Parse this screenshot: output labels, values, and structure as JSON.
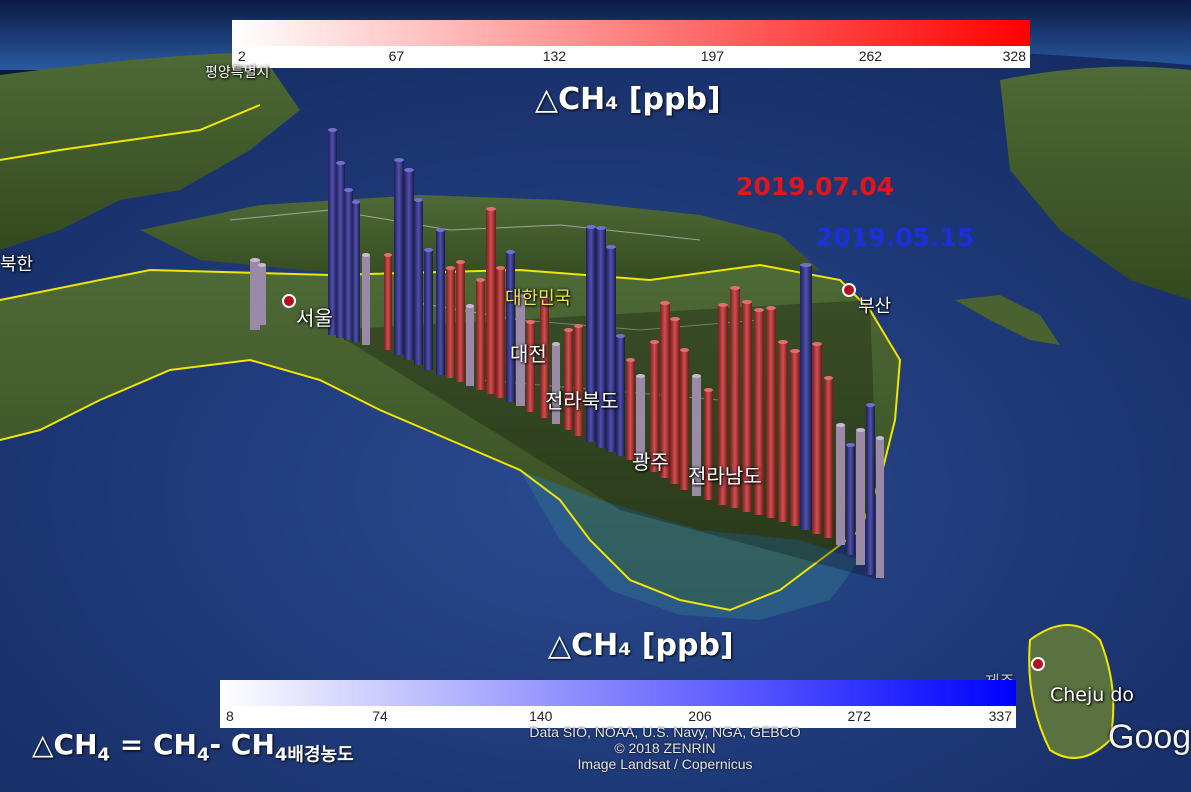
{
  "colorbar_red": {
    "ticks": [
      "2",
      "67",
      "132",
      "197",
      "262",
      "328"
    ],
    "start_color": "#ffffff",
    "end_color": "#ff0000"
  },
  "colorbar_blue": {
    "ticks": [
      "8",
      "74",
      "140",
      "206",
      "272",
      "337"
    ],
    "start_color": "#ffffff",
    "end_color": "#0000ff"
  },
  "unit_label_top": "△CH₄ [ppb]",
  "unit_label_bottom": "△CH₄ [ppb]",
  "dates": {
    "red": {
      "text": "2019.07.04",
      "color": "#e0161c"
    },
    "blue": {
      "text": "2019.05.15",
      "color": "#1a2fe0"
    }
  },
  "map_labels": {
    "north_korea": "북한",
    "pyongyang": "평양특별시",
    "seoul": "서울",
    "south_korea": "대한민국",
    "daejeon": "대전",
    "jeonbuk": "전라북도",
    "gwangju": "광주",
    "jeonnam": "전라남도",
    "busan": "부산",
    "jeju_hangul": "제주",
    "jeju": "Cheju do"
  },
  "attribution": [
    "Data SIO, NOAA, U.S. Navy, NGA, GEBCO",
    "© 2018 ZENRIN",
    "Image Landsat / Copernicus"
  ],
  "google_logo": "Goog",
  "formula": {
    "lhs_sym": "△CH",
    "lhs_sub": "4",
    "eq": " = CH",
    "ch4_sub": "4",
    "minus": "- CH",
    "bg_sub": "4배경농도"
  },
  "colors": {
    "sea": "#1d3a78",
    "land": "#3f5a28",
    "border": "#f2e600",
    "red_bar": "#b83a3a",
    "blue_bar": "#3a3a9a"
  }
}
